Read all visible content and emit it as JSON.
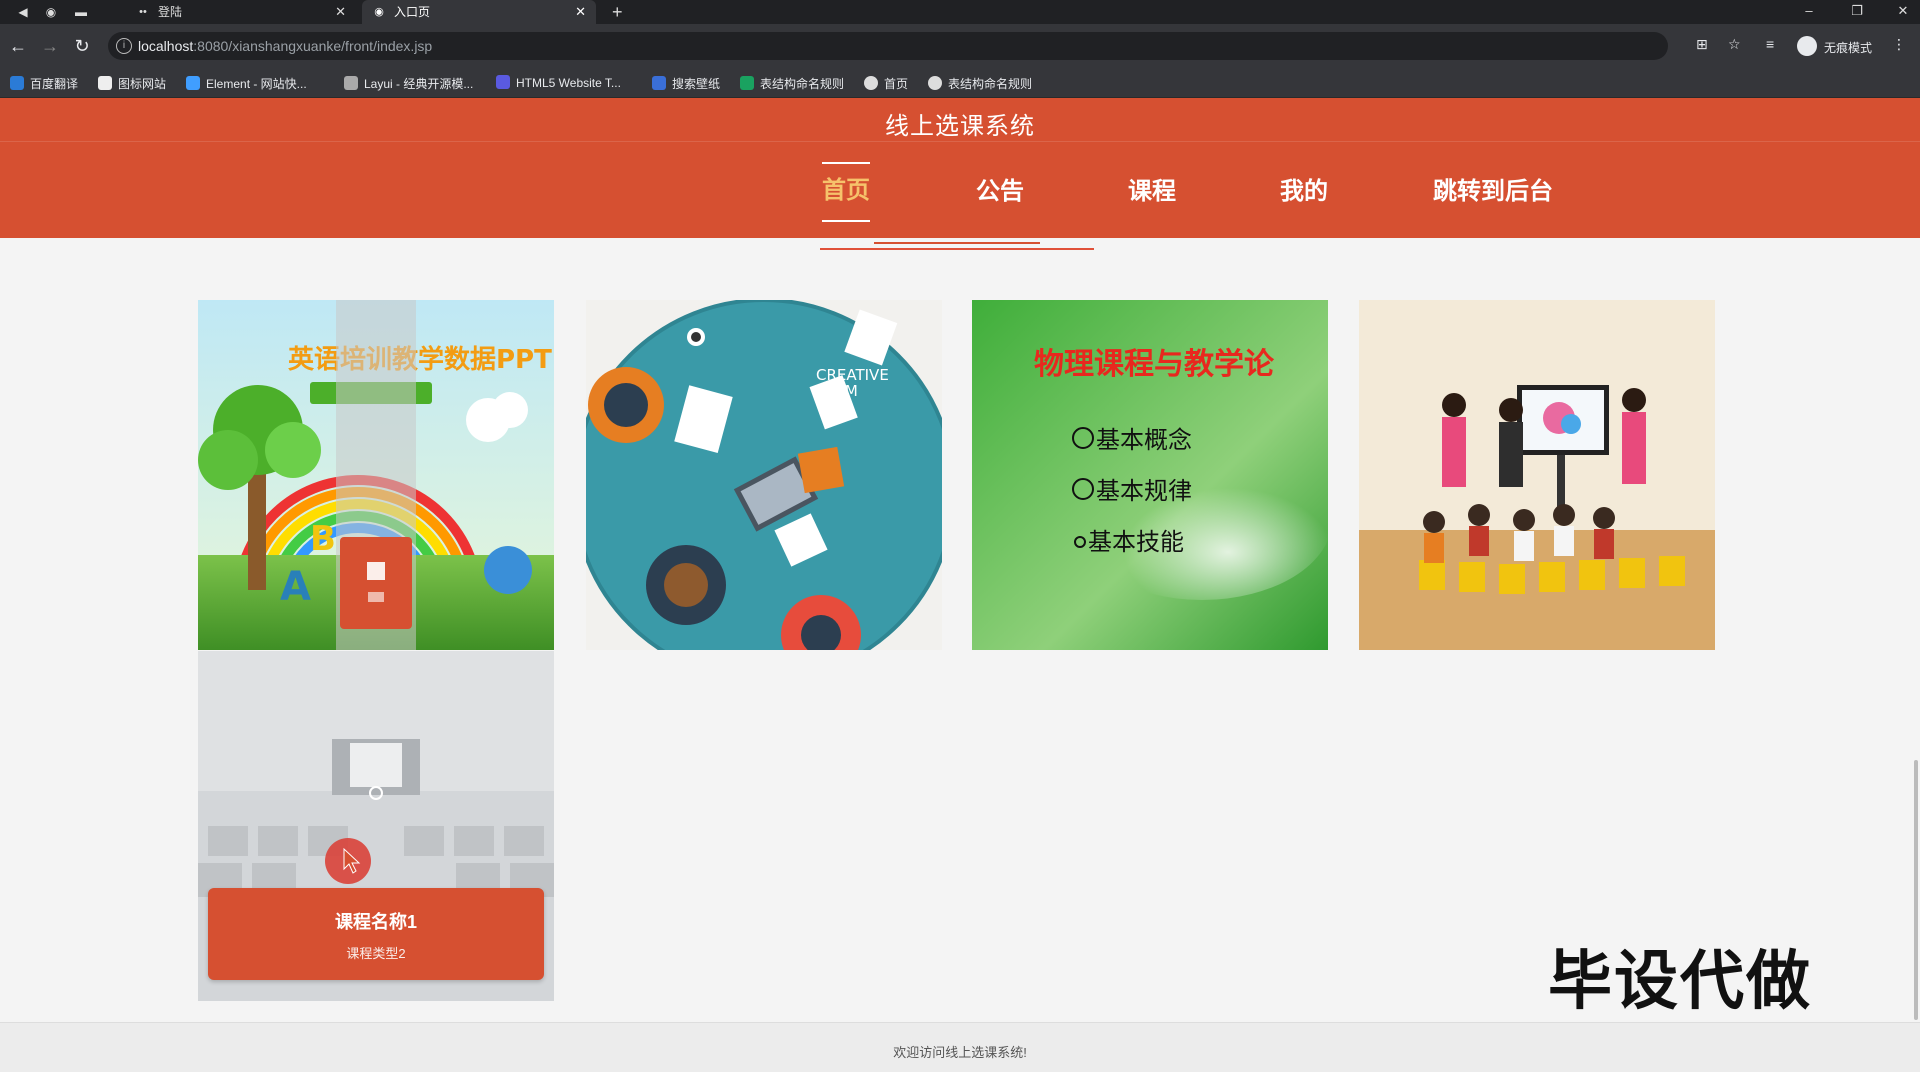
{
  "browser": {
    "tabs": [
      {
        "title": "登陆",
        "active": false
      },
      {
        "title": "入口页",
        "active": true
      }
    ],
    "url_host": "localhost",
    "url_path": ":8080/xianshangxuanke/front/index.jsp",
    "profile_label": "无痕模式",
    "bookmarks": [
      {
        "label": "百度翻译",
        "color": "#2b7bd6"
      },
      {
        "label": "图标网站",
        "color": "#eeeeee"
      },
      {
        "label": "Element - 网站快...",
        "color": "#409eff"
      },
      {
        "label": "Layui - 经典开源模...",
        "color": "#aaaaaa"
      },
      {
        "label": "HTML5 Website T...",
        "color": "#5a5ae0"
      },
      {
        "label": "搜索壁纸",
        "color": "#3a6fd8"
      },
      {
        "label": "表结构命名规则",
        "color": "#1aa260"
      },
      {
        "label": "首页",
        "color": "#dddddd"
      },
      {
        "label": "表结构命名规则",
        "color": "#dddddd"
      }
    ]
  },
  "site": {
    "title": "线上选课系统",
    "nav": [
      {
        "label": "首页",
        "active": true
      },
      {
        "label": "公告",
        "active": false
      },
      {
        "label": "课程",
        "active": false
      },
      {
        "label": "我的",
        "active": false
      },
      {
        "label": "跳转到后台",
        "active": false
      }
    ],
    "colors": {
      "primary": "#d65031",
      "active_nav": "#f6c26b"
    }
  },
  "cards": [
    {
      "image": "english-rainbow-ppt",
      "caption": "英语培训教学数据PPT"
    },
    {
      "image": "creative-team-desk",
      "caption": "CREATIVE TEAM"
    },
    {
      "image": "physics-slide",
      "caption": "物理课程与教学论",
      "bullets": [
        "基本概念",
        "基本规律",
        "基本技能"
      ]
    },
    {
      "image": "classroom-children",
      "caption": ""
    },
    {
      "image": "computer-lab",
      "course_name": "课程名称1",
      "course_type": "课程类型2"
    }
  ],
  "watermark": "毕设代做",
  "footer": {
    "text": "欢迎访问线上选课系统!"
  }
}
